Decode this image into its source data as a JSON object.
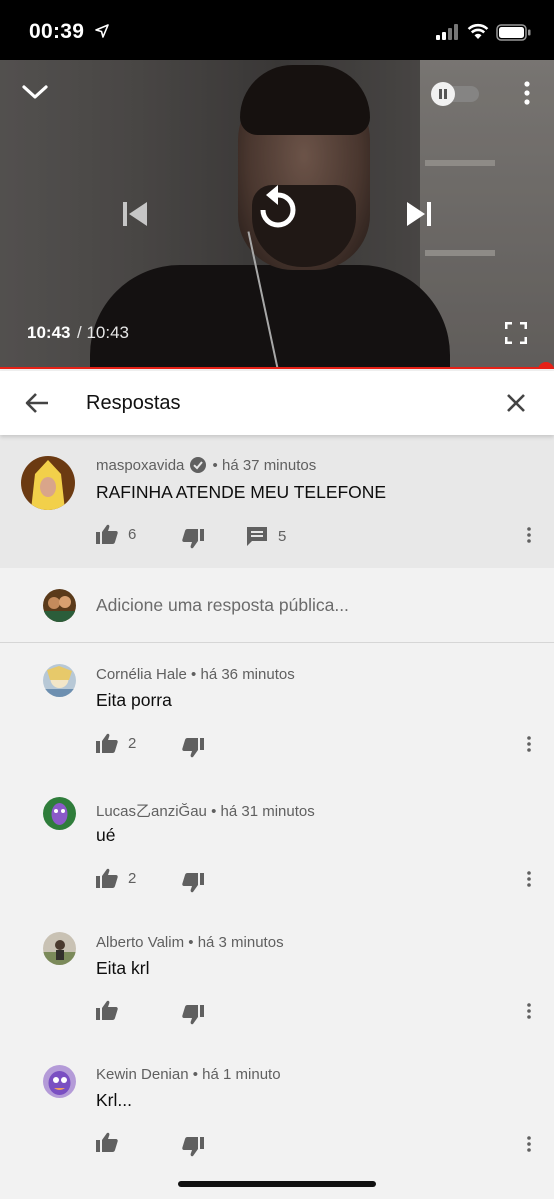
{
  "status_bar": {
    "time": "00:39"
  },
  "player": {
    "current_time": "10:43",
    "total_time": "/ 10:43",
    "progress_fraction": 1.0,
    "accent_color": "#e62117"
  },
  "header": {
    "title": "Respostas"
  },
  "parent_comment": {
    "author": "maspoxavida",
    "time": "há 37 minutos",
    "text": "RAFINHA ATENDE MEU TELEFONE",
    "likes": "6",
    "replies": "5"
  },
  "add_reply": {
    "placeholder": "Adicione uma resposta pública..."
  },
  "replies": [
    {
      "author": "Cornélia Hale",
      "time": "há 36 minutos",
      "text": "Eita porra",
      "likes": "2"
    },
    {
      "author": "Lucas乙anziĞau",
      "time": "há 31 minutos",
      "text": "ué",
      "likes": "2"
    },
    {
      "author": "Alberto Valim",
      "time": "há 3 minutos",
      "text": "Eita krl",
      "likes": ""
    },
    {
      "author": "Kewin Denian",
      "time": "há 1 minuto",
      "text": "Krl...",
      "likes": ""
    }
  ],
  "icons": [
    "location-arrow-icon",
    "signal-icon",
    "wifi-icon",
    "battery-icon",
    "chevron-down-icon",
    "pause-toggle-icon",
    "more-vert-icon",
    "previous-icon",
    "replay-icon",
    "next-icon",
    "fullscreen-icon",
    "back-arrow-icon",
    "close-icon",
    "thumb-up-icon",
    "thumb-down-icon",
    "reply-comment-icon",
    "verified-badge-icon"
  ]
}
